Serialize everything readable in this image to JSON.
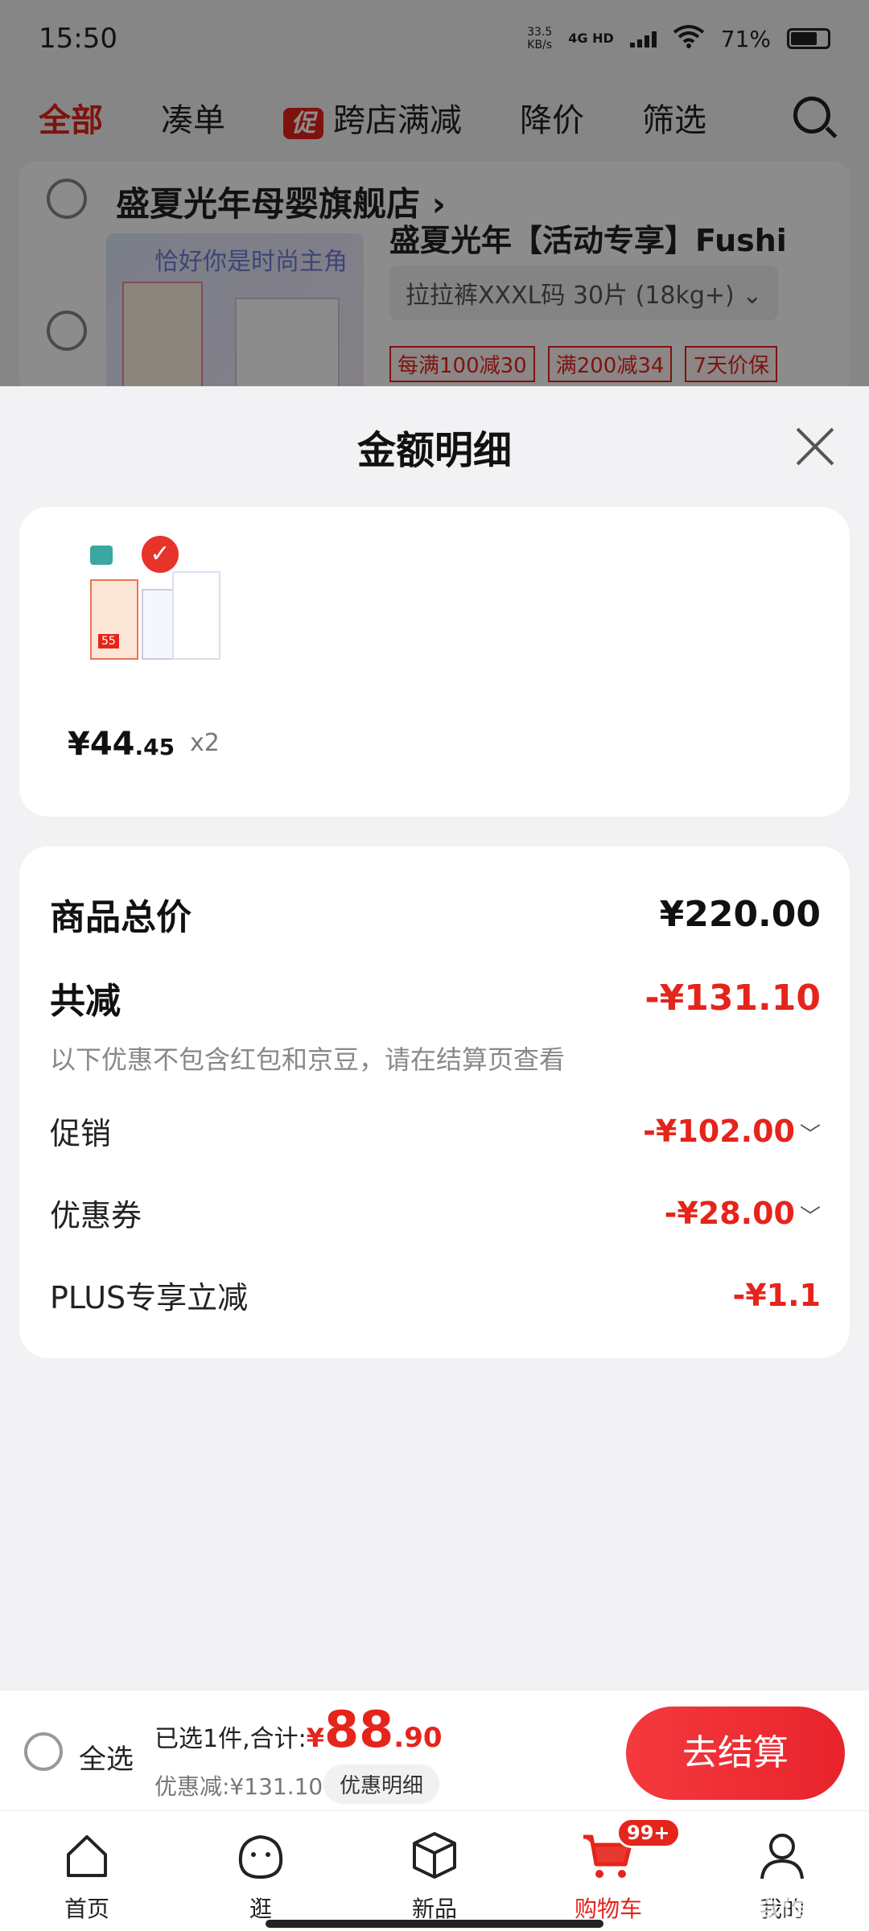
{
  "status_bar": {
    "time": "15:50",
    "net_speed": "33.5\nKB/s",
    "network": "4G HD",
    "battery": "71%"
  },
  "top_tabs": {
    "all": "全部",
    "bundle": "凑单",
    "promo_badge": "促",
    "cross_store": "跨店满减",
    "price_drop": "降价",
    "filter": "筛选"
  },
  "store": {
    "name": "盛夏光年母婴旗舰店",
    "product_title": "盛夏光年【活动专享】Fushi",
    "image_caption": "恰好你是时尚主角",
    "spec": "拉拉裤XXXL码 30片 (18kg+)",
    "tags": [
      "每满100减30",
      "满200减34",
      "7天价保"
    ]
  },
  "sheet": {
    "title": "金额明细",
    "item": {
      "price_int": "¥44",
      "price_dec": ".45",
      "qty": "x2",
      "thumb_price_label": "55"
    },
    "total_label": "商品总价",
    "total_value": "¥220.00",
    "discount_label": "共减",
    "discount_value": "-¥131.10",
    "discount_note": "以下优惠不包含红包和京豆，请在结算页查看",
    "promo_label": "促销",
    "promo_value": "-¥102.00",
    "coupon_label": "优惠券",
    "coupon_value": "-¥28.00",
    "plus_label": "PLUS专享立减",
    "plus_value": "-¥1.1"
  },
  "checkout": {
    "select_all": "全选",
    "summary_prefix": "已选1件,合计:",
    "currency": "¥",
    "amount_int": "88",
    "amount_dec": ".90",
    "discount_text": "优惠减:¥131.10",
    "detail_button": "优惠明细",
    "checkout_button": "去结算"
  },
  "nav": {
    "home": "首页",
    "browse": "逛",
    "new": "新品",
    "cart": "购物车",
    "cart_badge": "99+",
    "me": "我的"
  },
  "watermark": "值值值",
  "colors": {
    "accent": "#e5241b",
    "sheet_bg": "#f2f2f4"
  }
}
